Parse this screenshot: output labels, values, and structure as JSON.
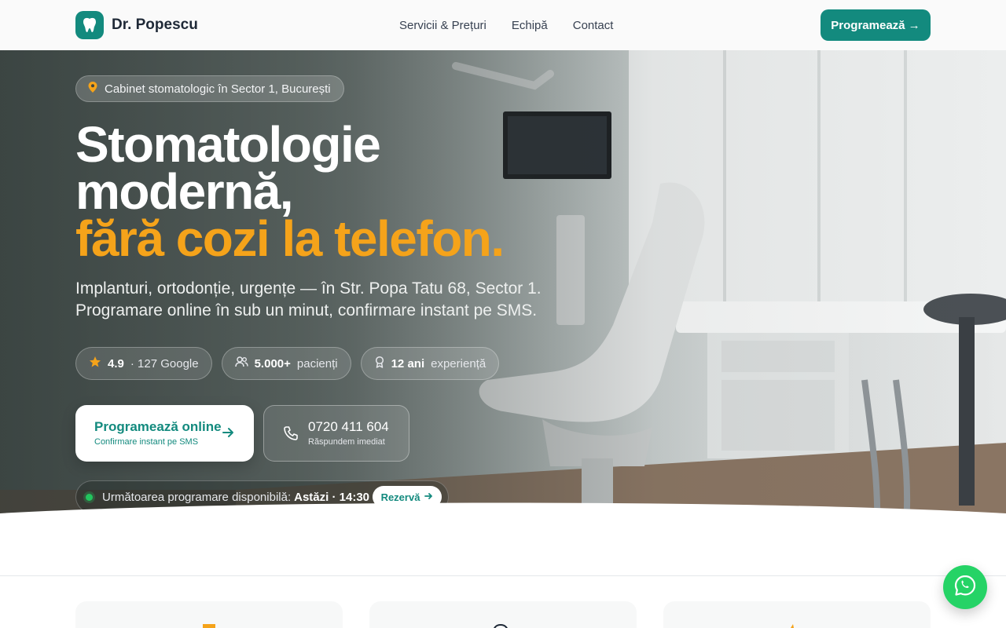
{
  "brand": {
    "name": "Dr. Popescu",
    "accent": "#138a7e",
    "highlight": "#f5a31a",
    "logo_icon": "tooth-icon"
  },
  "nav": {
    "items": [
      {
        "label": "Servicii & Prețuri"
      },
      {
        "label": "Echipă"
      },
      {
        "label": "Contact"
      }
    ],
    "cta_label": "Programează →"
  },
  "hero": {
    "location": "Cabinet stomatologic în Sector 1, București",
    "headline": {
      "line1": "Stomatologie",
      "line2": "modernă,",
      "line3": "fără cozi la telefon."
    },
    "subtext": {
      "line1": "Implanturi, ortodonție, urgențe — în Str. Popa Tatu 68, Sector 1.",
      "line2": "Programare online în sub un minut, confirmare instant pe SMS."
    },
    "stats": [
      {
        "icon": "star-icon",
        "bold": "4.9",
        "rest": "· 127 Google"
      },
      {
        "icon": "users-icon",
        "bold": "5.000+",
        "rest": "pacienți"
      },
      {
        "icon": "award-icon",
        "bold": "12 ani",
        "rest": "experiență"
      }
    ],
    "cta_online": {
      "title": "Programează online",
      "subtitle": "Confirmare instant pe SMS"
    },
    "cta_phone": {
      "number": "0720 411 604",
      "subtitle": "Răspundem imediat"
    },
    "availability": {
      "label": "Următoarea programare disponibilă:",
      "value": "Astăzi · 14:30",
      "button": "Rezervă"
    }
  },
  "floating": {
    "icon": "whatsapp-icon",
    "color": "#25d366"
  }
}
